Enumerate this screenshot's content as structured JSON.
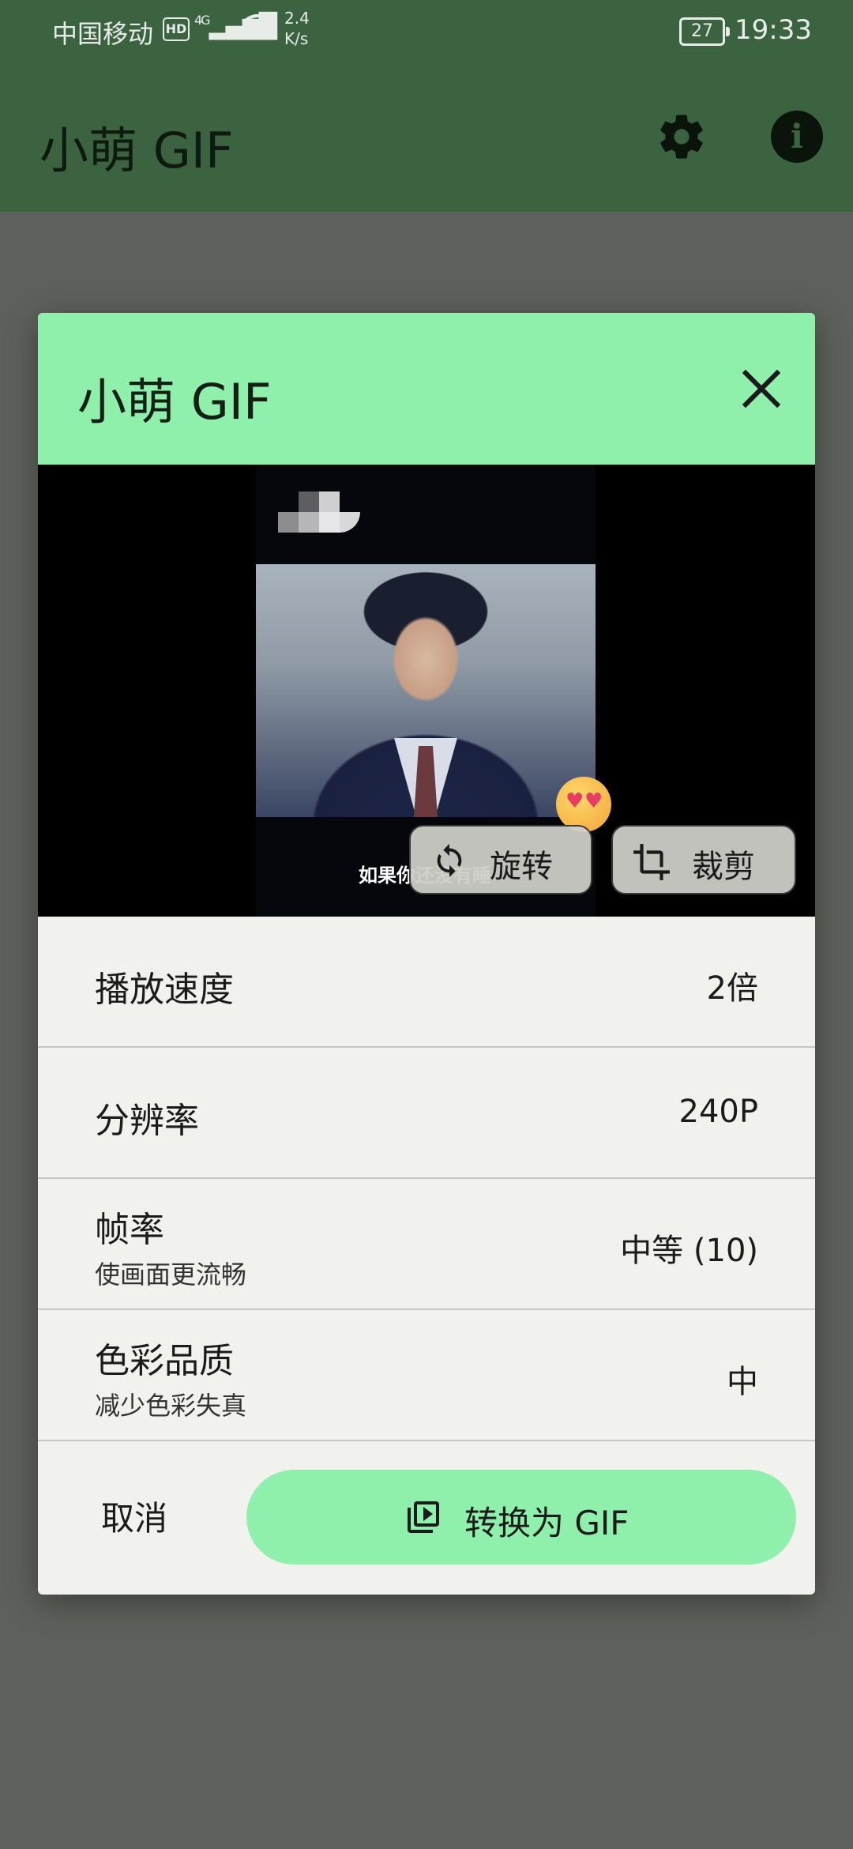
{
  "status_bar": {
    "carrier": "中国移动",
    "hd": "HD",
    "network": "4G",
    "speed_value": "2.4",
    "speed_unit": "K/s",
    "battery": "27",
    "time": "19:33"
  },
  "app_bar": {
    "title": "小萌 GIF",
    "icons": [
      "gear-icon",
      "info-icon"
    ]
  },
  "dialog": {
    "title": "小萌 GIF",
    "preview": {
      "subtitle": "如果你还没有睡",
      "rotate_label": "旋转",
      "crop_label": "裁剪"
    },
    "settings": [
      {
        "label": "播放速度",
        "value": "2倍"
      },
      {
        "label": "分辨率",
        "value": "240P"
      },
      {
        "label": "帧率",
        "subtitle": "使画面更流畅",
        "value": "中等 (10)"
      },
      {
        "label": "色彩品质",
        "subtitle": "减少色彩失真",
        "value": "中"
      }
    ],
    "cancel_label": "取消",
    "convert_label": "转换为 GIF"
  },
  "colors": {
    "accent": "#8ff0ac",
    "app_bar": "#3b6340",
    "scrim_bg": "#5e605c",
    "dialog_bg": "#f1f1ed"
  }
}
